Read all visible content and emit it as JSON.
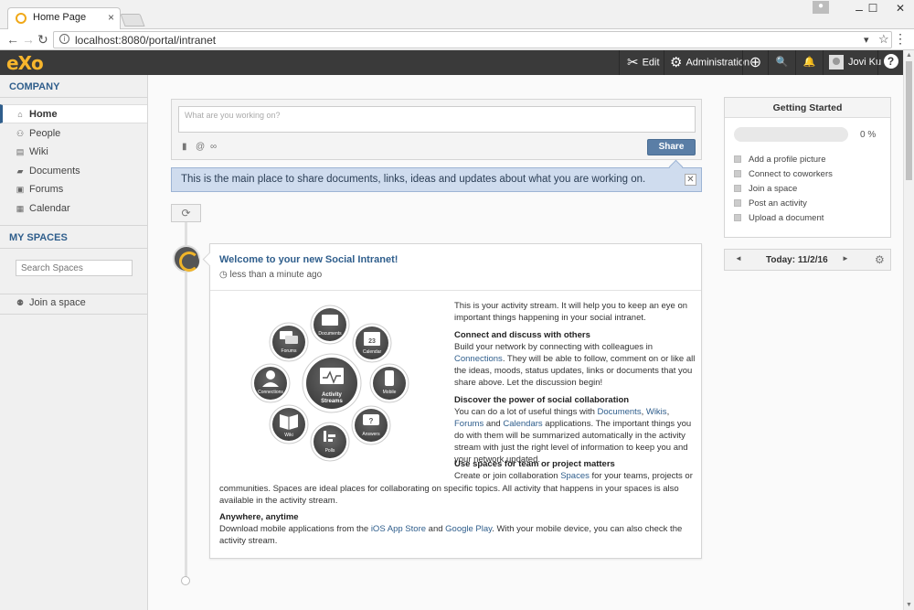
{
  "browser": {
    "tab_title": "Home Page",
    "tab_close": "×",
    "url": "localhost:8080/portal/intranet",
    "url_icon": "i",
    "window_buttons": [
      "–",
      "☐",
      "✕"
    ],
    "bookmark_icon": "☆",
    "extension_icon": "▾",
    "menu_dots": "⋮"
  },
  "toolbar": {
    "logo": "eXo",
    "edit_label": "Edit",
    "admin_label": "Administration",
    "user_name": "Jovi Ku",
    "add_glyph": "⊕",
    "search_glyph": "🔍",
    "bell_glyph": "🔔",
    "help_glyph": "?",
    "edit_glyph": "✂",
    "admin_glyph": "⚙"
  },
  "sidebar": {
    "company_heading": "COMPANY",
    "items": [
      {
        "label": "Home",
        "icon": "home-icon",
        "glyph": "⌂"
      },
      {
        "label": "People",
        "icon": "people-icon",
        "glyph": "⚇"
      },
      {
        "label": "Wiki",
        "icon": "wiki-icon",
        "glyph": "▤"
      },
      {
        "label": "Documents",
        "icon": "folder-icon",
        "glyph": "▰"
      },
      {
        "label": "Forums",
        "icon": "forums-icon",
        "glyph": "▣"
      },
      {
        "label": "Calendar",
        "icon": "calendar-icon",
        "glyph": "▦"
      }
    ],
    "spaces_heading": "MY SPACES",
    "search_placeholder": "Search Spaces",
    "join_label": "Join a space",
    "join_glyph": "⚉"
  },
  "composer": {
    "placeholder": "What are you working on?",
    "share_label": "Share"
  },
  "tip": {
    "text": "This is the main place to share documents, links, ideas and updates about what you are working on.",
    "close": "✕"
  },
  "activity": {
    "title": "Welcome to your new Social Intranet!",
    "time": "less than a minute ago",
    "intro": "This is your activity stream. It will help you to keep an eye on important things happening in your social intranet.",
    "s1_head": "Connect and discuss with others",
    "s1_a": "Build your network by connecting with colleagues in ",
    "s1_link": "Connections",
    "s1_b": ". They will be able to follow, comment on or like all the ideas, moods, status updates, links or documents that you share above. Let the discussion begin!",
    "s2_head": "Discover the power of social collaboration",
    "s2_a": "You can do a lot of useful things with ",
    "s2_l1": "Documents",
    "s2_c1": ", ",
    "s2_l2": "Wikis",
    "s2_c2": ", ",
    "s2_l3": "Forums",
    "s2_c3": " and ",
    "s2_l4": "Calendars",
    "s2_b": " applications. The important things you do with them will be summarized automatically in the activity stream with just the right level of information to keep you and your network updated.",
    "s3_head": "Use spaces for team or project matters",
    "s3_a": "Create or join collaboration ",
    "s3_link": "Spaces",
    "s3_b": " for your teams, projects or",
    "s3_c": "communities. Spaces are ideal places for collaborating on specific topics. All activity that happens in your spaces is also available in the activity stream.",
    "s4_head": "Anywhere, anytime",
    "s4_a": "Download mobile applications from the ",
    "s4_l1": "iOS App Store",
    "s4_c": " and ",
    "s4_l2": "Google Play",
    "s4_b": ". With your mobile device, you can also check the activity stream.",
    "diagram": {
      "center": [
        "Activity",
        "Streams"
      ],
      "nodes": [
        "Documents",
        "Calendar",
        "Mobile",
        "Answers",
        "Polls",
        "Wiki",
        "Connections",
        "Forums"
      ],
      "calendar_day": "23"
    }
  },
  "getting_started": {
    "title": "Getting Started",
    "progress": 0,
    "progress_label": "0 %",
    "items": [
      "Add a profile picture",
      "Connect to coworkers",
      "Join a space",
      "Post an activity",
      "Upload a document"
    ]
  },
  "calendar": {
    "today": "Today: 11/2/16",
    "prev": "◄",
    "next": "►",
    "gear": "⚙"
  },
  "colors": {
    "toolbar_bg": "#3a3a3a",
    "accent": "#2f5e8c",
    "logo": "#f7b52c",
    "share_button": "#5a7ea6",
    "tip_bg": "#cfdcee"
  }
}
